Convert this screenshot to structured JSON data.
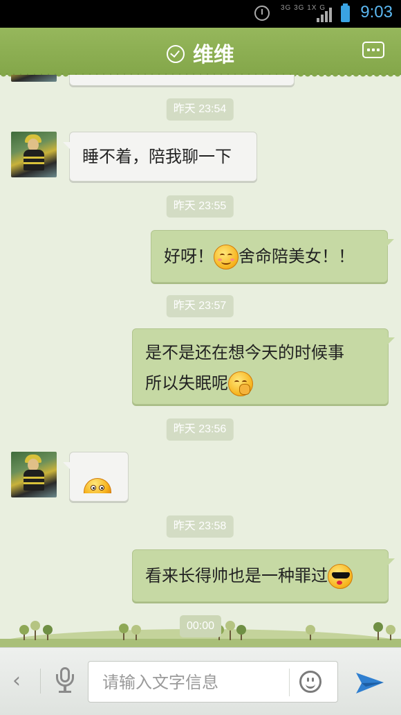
{
  "status_bar": {
    "clock": "9:03",
    "network": "3G 3G 1X G",
    "accent_color": "#5bb7f0"
  },
  "header": {
    "title": "维维",
    "online_icon": "check-circle-icon",
    "menu_icon": "more-dots-icon",
    "color": "#8cae52"
  },
  "messages": [
    {
      "type": "time",
      "text": "昨天 23:54"
    },
    {
      "type": "incoming",
      "text": "睡不着，陪我聊一下"
    },
    {
      "type": "time",
      "text": "昨天 23:55"
    },
    {
      "type": "outgoing",
      "text_before": "好呀！",
      "emoji": "blushing-smile-emoji",
      "text_after": "舍命陪美女！！"
    },
    {
      "type": "time",
      "text": "昨天 23:57"
    },
    {
      "type": "outgoing",
      "line1": "是不是还在想今天的时候事",
      "line2": "所以失眠呢",
      "emoji": "thinking-emoji"
    },
    {
      "type": "time",
      "text": "昨天 23:56"
    },
    {
      "type": "incoming",
      "emoji": "peeking-face-emoji"
    },
    {
      "type": "time",
      "text": "昨天 23:58"
    },
    {
      "type": "outgoing",
      "text": "看来长得帅也是一种罪过",
      "emoji": "cool-sunglasses-emoji"
    },
    {
      "type": "time",
      "text": "00:00"
    }
  ],
  "input_bar": {
    "placeholder": "请输入文字信息",
    "back_icon": "chevron-left-icon",
    "voice_icon": "microphone-icon",
    "emoji_icon": "smiley-icon",
    "send_icon": "send-paper-plane-icon",
    "send_color": "#2f7fd0"
  }
}
